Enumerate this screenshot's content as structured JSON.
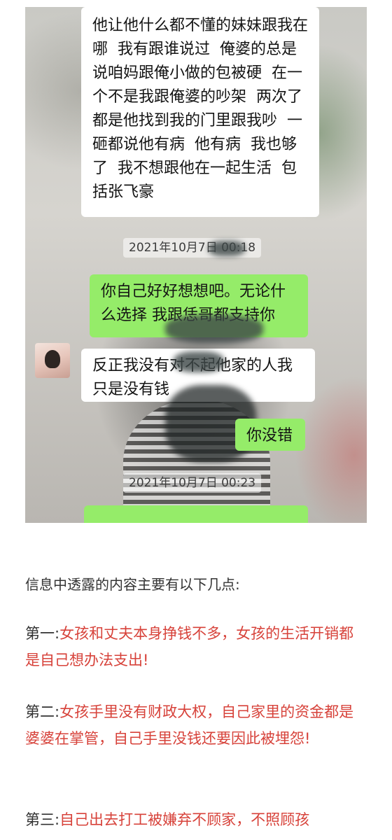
{
  "chat_screenshot": {
    "messages": [
      {
        "side": "left",
        "text": "他让他什么都不懂的妹妹跟我在哪  我有跟谁说过  俺婆的总是说咱妈跟俺小做的包被硬  在一个不是我跟俺婆的吵架  两次了  都是他找到我的门里跟我吵  一砸都说他有病  他有病  我也够了  我不想跟他在一起生活  包括张飞豪"
      },
      {
        "side": "right",
        "text": "你自己好好想想吧。无论什么选择 我跟恁哥都支持你"
      },
      {
        "side": "left",
        "text": "反正我没有对不起他家的人我只是没有钱"
      },
      {
        "side": "right",
        "text": "你没错"
      }
    ],
    "timestamps": [
      "2021年10月7日 00:18",
      "2021年10月7日 00:23"
    ]
  },
  "article": {
    "intro": "信息中透露的内容主要有以下几点:",
    "points": [
      {
        "prefix": "第一:",
        "text": "女孩和丈夫本身挣钱不多，女孩的生活开销都是自己想办法支出!"
      },
      {
        "prefix": "第二:",
        "text": "女孩手里没有财政大权，自己家里的资金都是婆婆在掌管，自己手里没钱还要因此被埋怨!"
      },
      {
        "prefix": "第三:",
        "text": "自己出去打工被嫌弃不顾家，不照顾孩"
      }
    ]
  },
  "colors": {
    "incoming_bubble": "#ffffff",
    "outgoing_bubble": "#95ec69",
    "highlight_text": "#d7423a",
    "body_text": "#333333"
  }
}
